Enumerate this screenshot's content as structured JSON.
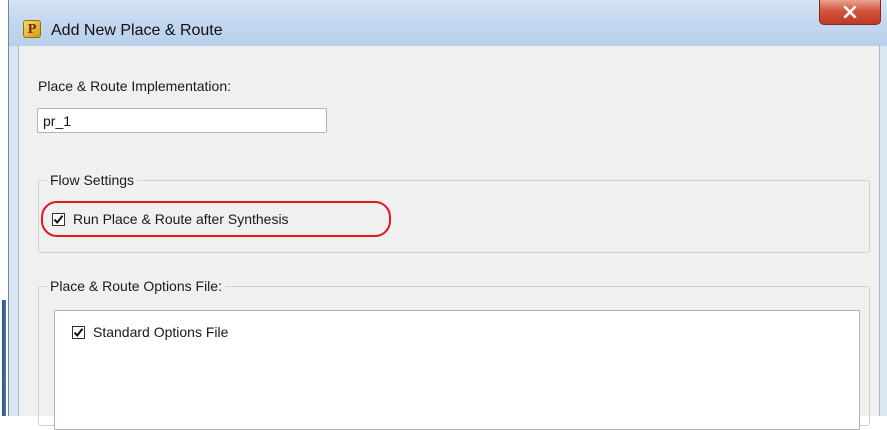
{
  "window": {
    "title": "Add New Place & Route",
    "icon": "place-route-app-icon",
    "icon_glyph": "P",
    "close_glyph": "X"
  },
  "implementation": {
    "label": "Place & Route Implementation:",
    "value": "pr_1"
  },
  "flow_settings": {
    "legend": "Flow Settings",
    "run_after_synthesis": {
      "label": "Run Place & Route after Synthesis",
      "checked": true
    }
  },
  "options_file": {
    "legend": "Place & Route Options File:",
    "items": [
      {
        "label": "Standard Options File",
        "checked": true
      }
    ]
  },
  "colors": {
    "highlight": "#e0181f",
    "close_button": "#c13a22",
    "titlebar": "#c4d8ef"
  }
}
